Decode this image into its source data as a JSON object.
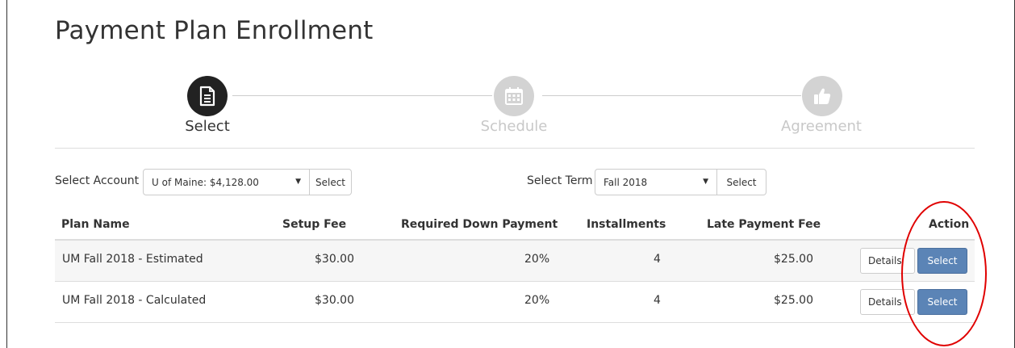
{
  "page": {
    "title": "Payment Plan Enrollment"
  },
  "steps": [
    {
      "label": "Select",
      "icon": "document-icon",
      "state": "active"
    },
    {
      "label": "Schedule",
      "icon": "calendar-icon",
      "state": "inactive"
    },
    {
      "label": "Agreement",
      "icon": "thumbs-up-icon",
      "state": "inactive"
    }
  ],
  "filters": {
    "account": {
      "label": "Select Account",
      "value": "U of Maine: $4,128.00",
      "button": "Select"
    },
    "term": {
      "label": "Select Term",
      "value": "Fall 2018",
      "button": "Select"
    }
  },
  "table": {
    "headers": [
      "Plan Name",
      "Setup Fee",
      "Required Down Payment",
      "Installments",
      "Late Payment Fee",
      "Action"
    ],
    "rows": [
      {
        "name": "UM Fall 2018 - Estimated",
        "setup_fee": "$30.00",
        "down_payment": "20%",
        "installments": "4",
        "late_fee": "$25.00",
        "details": "Details",
        "select": "Select"
      },
      {
        "name": "UM Fall 2018 - Calculated",
        "setup_fee": "$30.00",
        "down_payment": "20%",
        "installments": "4",
        "late_fee": "$25.00",
        "details": "Details",
        "select": "Select"
      }
    ]
  },
  "colors": {
    "active_step": "#222222",
    "inactive_step": "#d3d3d3",
    "primary_button": "#5b84b6",
    "annotation": "#e00000"
  }
}
